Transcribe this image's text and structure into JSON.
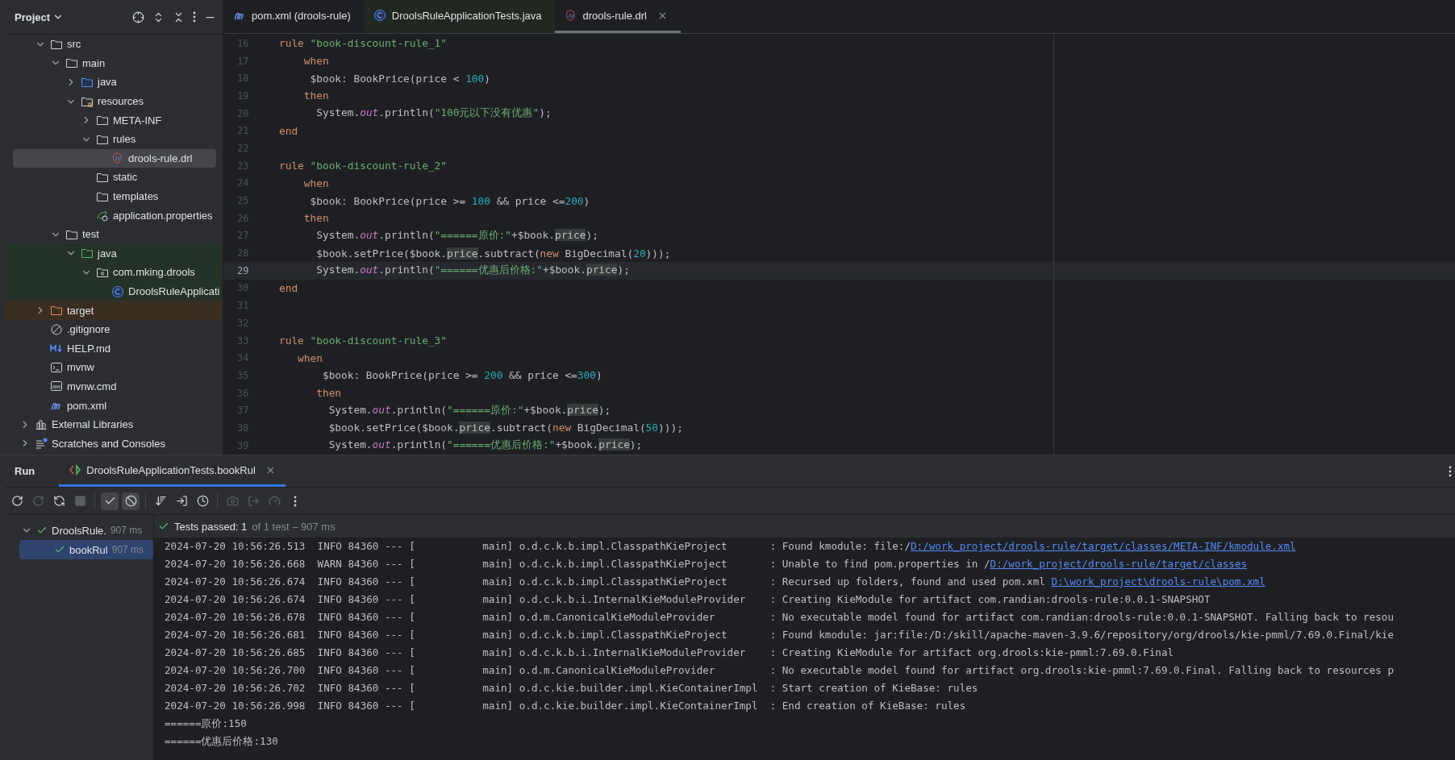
{
  "project_panel": {
    "title": "Project",
    "tree": {
      "nested_items": [
        {
          "label": "src",
          "kind": "folder",
          "expanded": true,
          "selected": false,
          "children": [
            {
              "label": "main",
              "kind": "folder",
              "expanded": true,
              "selected": false,
              "children": [
                {
                  "label": "java",
                  "kind": "source-folder",
                  "expanded": false,
                  "selected": false
                },
                {
                  "label": "resources",
                  "kind": "resource-folder",
                  "expanded": true,
                  "selected": false,
                  "children": [
                    {
                      "label": "META-INF",
                      "kind": "folder",
                      "expanded": false,
                      "selected": false
                    },
                    {
                      "label": "rules",
                      "kind": "folder",
                      "expanded": true,
                      "selected": false,
                      "children": [
                        {
                          "label": "drools-rule.drl",
                          "kind": "drl",
                          "selected": true
                        }
                      ]
                    },
                    {
                      "label": "static",
                      "kind": "folder",
                      "selected": false
                    },
                    {
                      "label": "templates",
                      "kind": "folder",
                      "selected": false
                    },
                    {
                      "label": "application.properties",
                      "kind": "properties",
                      "selected": false
                    }
                  ]
                }
              ]
            },
            {
              "label": "test",
              "kind": "folder",
              "expanded": true,
              "selected": false,
              "children": [
                {
                  "label": "java",
                  "kind": "test-folder",
                  "expanded": true,
                  "selected": false,
                  "test_source": true,
                  "children": [
                    {
                      "label": "com.mking.drools",
                      "kind": "package",
                      "expanded": true,
                      "selected": false,
                      "test_source": true,
                      "children": [
                        {
                          "label": "DroolsRuleApplicati",
                          "kind": "class",
                          "selected": false,
                          "test_source": true
                        }
                      ]
                    }
                  ]
                }
              ]
            }
          ]
        },
        {
          "label": "target",
          "kind": "excluded-folder",
          "expanded": false,
          "selected": false,
          "excluded": true
        },
        {
          "label": ".gitignore",
          "kind": "ignore",
          "selected": false
        },
        {
          "label": "HELP.md",
          "kind": "markdown",
          "selected": false
        },
        {
          "label": "mvnw",
          "kind": "shell",
          "selected": false
        },
        {
          "label": "mvnw.cmd",
          "kind": "cmd",
          "selected": false
        },
        {
          "label": "pom.xml",
          "kind": "maven",
          "selected": false
        }
      ],
      "top_items": [
        {
          "label": "External Libraries",
          "kind": "library",
          "expanded": false,
          "selected": false
        },
        {
          "label": "Scratches and Consoles",
          "kind": "scratches",
          "expanded": false,
          "selected": false
        }
      ]
    }
  },
  "editor": {
    "tabs": [
      {
        "label": "pom.xml (drools-rule)",
        "kind": "maven",
        "selected": false
      },
      {
        "label": "DroolsRuleApplicationTests.java",
        "kind": "class",
        "selected": false,
        "test_source": true
      },
      {
        "label": "drools-rule.drl",
        "kind": "drl",
        "selected": true
      }
    ],
    "lines": [
      {
        "number": "16",
        "current": false,
        "tokens": [
          {
            "kind": "keyword",
            "text": "rule "
          },
          {
            "kind": "string",
            "text": "\"book-discount-rule_1\""
          }
        ]
      },
      {
        "number": "17",
        "current": false,
        "tokens": [
          {
            "kind": "keyword",
            "text": "    when"
          }
        ]
      },
      {
        "number": "18",
        "current": false,
        "tokens": [
          {
            "kind": "plain",
            "text": "     $book: BookPrice(price < "
          },
          {
            "kind": "number",
            "text": "100"
          },
          {
            "kind": "plain",
            "text": ")"
          }
        ]
      },
      {
        "number": "19",
        "current": false,
        "tokens": [
          {
            "kind": "keyword",
            "text": "    then"
          }
        ]
      },
      {
        "number": "20",
        "current": false,
        "tokens": [
          {
            "kind": "plain",
            "text": "      System."
          },
          {
            "kind": "field",
            "text": "out"
          },
          {
            "kind": "plain",
            "text": ".println("
          },
          {
            "kind": "string",
            "text": "\"100元以下没有优惠\""
          },
          {
            "kind": "plain",
            "text": ");"
          }
        ]
      },
      {
        "number": "21",
        "current": false,
        "tokens": [
          {
            "kind": "keyword",
            "text": "end"
          }
        ]
      },
      {
        "number": "22",
        "current": false
      },
      {
        "number": "23",
        "current": false,
        "tokens": [
          {
            "kind": "keyword",
            "text": "rule "
          },
          {
            "kind": "string",
            "text": "\"book-discount-rule_2\""
          }
        ]
      },
      {
        "number": "24",
        "current": false,
        "tokens": [
          {
            "kind": "keyword",
            "text": "    when"
          }
        ]
      },
      {
        "number": "25",
        "current": false,
        "tokens": [
          {
            "kind": "plain",
            "text": "     $book: BookPrice(price >= "
          },
          {
            "kind": "number",
            "text": "100"
          },
          {
            "kind": "plain",
            "text": " && price <="
          },
          {
            "kind": "number",
            "text": "200"
          },
          {
            "kind": "plain",
            "text": ")"
          }
        ]
      },
      {
        "number": "26",
        "current": false,
        "tokens": [
          {
            "kind": "keyword",
            "text": "    then"
          }
        ]
      },
      {
        "number": "27",
        "current": false,
        "tokens": [
          {
            "kind": "plain",
            "text": "      System."
          },
          {
            "kind": "field",
            "text": "out"
          },
          {
            "kind": "plain",
            "text": ".println("
          },
          {
            "kind": "string",
            "text": "\"======原价:\""
          },
          {
            "kind": "plain",
            "text": "+$book."
          },
          {
            "kind": "ref",
            "text": "price"
          },
          {
            "kind": "plain",
            "text": ");"
          }
        ]
      },
      {
        "number": "28",
        "current": false,
        "tokens": [
          {
            "kind": "plain",
            "text": "      $book.setPrice($book."
          },
          {
            "kind": "ref",
            "text": "price"
          },
          {
            "kind": "plain",
            "text": ".subtract("
          },
          {
            "kind": "keyword",
            "text": "new"
          },
          {
            "kind": "plain",
            "text": " BigDecimal("
          },
          {
            "kind": "number",
            "text": "20"
          },
          {
            "kind": "plain",
            "text": ")));"
          }
        ]
      },
      {
        "number": "29",
        "current": true,
        "tokens": [
          {
            "kind": "plain",
            "text": "      System."
          },
          {
            "kind": "field",
            "text": "out"
          },
          {
            "kind": "plain",
            "text": ".println("
          },
          {
            "kind": "string",
            "text": "\"======优惠后价格:\""
          },
          {
            "kind": "plain",
            "text": "+$book."
          },
          {
            "kind": "ref",
            "text": "price"
          },
          {
            "kind": "plain",
            "text": ");"
          }
        ]
      },
      {
        "number": "30",
        "current": false,
        "tokens": [
          {
            "kind": "keyword",
            "text": "end"
          }
        ]
      },
      {
        "number": "31",
        "current": false
      },
      {
        "number": "32",
        "current": false
      },
      {
        "number": "33",
        "current": false,
        "tokens": [
          {
            "kind": "keyword",
            "text": "rule "
          },
          {
            "kind": "string",
            "text": "\"book-discount-rule_3\""
          }
        ]
      },
      {
        "number": "34",
        "current": false,
        "tokens": [
          {
            "kind": "keyword",
            "text": "   when"
          }
        ]
      },
      {
        "number": "35",
        "current": false,
        "tokens": [
          {
            "kind": "plain",
            "text": "       $book: BookPrice(price >= "
          },
          {
            "kind": "number",
            "text": "200"
          },
          {
            "kind": "plain",
            "text": " && price <="
          },
          {
            "kind": "number",
            "text": "300"
          },
          {
            "kind": "plain",
            "text": ")"
          }
        ]
      },
      {
        "number": "36",
        "current": false,
        "tokens": [
          {
            "kind": "keyword",
            "text": "      then"
          }
        ]
      },
      {
        "number": "37",
        "current": false,
        "tokens": [
          {
            "kind": "plain",
            "text": "        System."
          },
          {
            "kind": "field",
            "text": "out"
          },
          {
            "kind": "plain",
            "text": ".println("
          },
          {
            "kind": "string",
            "text": "\"======原价:\""
          },
          {
            "kind": "plain",
            "text": "+$book."
          },
          {
            "kind": "ref",
            "text": "price"
          },
          {
            "kind": "plain",
            "text": ");"
          }
        ]
      },
      {
        "number": "38",
        "current": false,
        "tokens": [
          {
            "kind": "plain",
            "text": "        $book.setPrice($book."
          },
          {
            "kind": "ref",
            "text": "price"
          },
          {
            "kind": "plain",
            "text": ".subtract("
          },
          {
            "kind": "keyword",
            "text": "new"
          },
          {
            "kind": "plain",
            "text": " BigDecimal("
          },
          {
            "kind": "number",
            "text": "50"
          },
          {
            "kind": "plain",
            "text": ")));"
          }
        ]
      },
      {
        "number": "39",
        "current": false,
        "tokens": [
          {
            "kind": "plain",
            "text": "        System."
          },
          {
            "kind": "field",
            "text": "out"
          },
          {
            "kind": "plain",
            "text": ".println("
          },
          {
            "kind": "string",
            "text": "\"======优惠后价格:\""
          },
          {
            "kind": "plain",
            "text": "+$book."
          },
          {
            "kind": "ref",
            "text": "price"
          },
          {
            "kind": "plain",
            "text": ");"
          }
        ]
      }
    ]
  },
  "run_panel": {
    "title": "Run",
    "tabs": [
      {
        "label": "DroolsRuleApplicationTests.bookRul",
        "selected": true
      }
    ],
    "toolbar": [
      {
        "kind": "rerun",
        "disabled": false,
        "on": false
      },
      {
        "kind": "rerun-failed",
        "disabled": true,
        "on": false
      },
      {
        "kind": "auto-rerun",
        "disabled": false,
        "on": false
      },
      {
        "kind": "stop",
        "disabled": true,
        "on": false
      },
      {
        "kind": "show-passed",
        "disabled": false,
        "on": true
      },
      {
        "kind": "show-ignored",
        "disabled": false,
        "on": true
      },
      {
        "kind": "sort",
        "disabled": false,
        "on": false
      },
      {
        "kind": "import",
        "disabled": false,
        "on": false
      },
      {
        "kind": "history",
        "disabled": false,
        "on": false
      },
      {
        "kind": "screenshot",
        "disabled": true,
        "on": false
      },
      {
        "kind": "export",
        "disabled": true,
        "on": false
      },
      {
        "kind": "coverage",
        "disabled": true,
        "on": false
      },
      {
        "kind": "more",
        "disabled": false,
        "on": false
      }
    ],
    "test_tree": [
      {
        "label": "DroolsRule.",
        "duration": "907 ms",
        "expanded": true,
        "selected": false,
        "children": [
          {
            "label": "bookRul",
            "duration": "907 ms",
            "selected": true
          }
        ]
      }
    ],
    "status": {
      "summary": "Tests passed: 1",
      "detail": "of 1 test – 907 ms"
    },
    "console": [
      {
        "text": "2024-07-20 10:56:26.513  INFO 84360 --- [           main] o.d.c.k.b.impl.ClasspathKieProject       : Found kmodule: file:/",
        "link": "D:/work_project/drools-rule/target/classes/META-INF/kmodule.xml"
      },
      {
        "text": "2024-07-20 10:56:26.668  WARN 84360 --- [           main] o.d.c.k.b.impl.ClasspathKieProject       : Unable to find pom.properties in /",
        "link": "D:/work_project/drools-rule/target/classes"
      },
      {
        "text": "2024-07-20 10:56:26.674  INFO 84360 --- [           main] o.d.c.k.b.impl.ClasspathKieProject       : Recursed up folders, found and used pom.xml ",
        "link": "D:\\work_project\\drools-rule\\pom.xml"
      },
      {
        "text": "2024-07-20 10:56:26.674  INFO 84360 --- [           main] o.d.c.k.b.i.InternalKieModuleProvider    : Creating KieModule for artifact com.randian:drools-rule:0.0.1-SNAPSHOT"
      },
      {
        "text": "2024-07-20 10:56:26.678  INFO 84360 --- [           main] o.d.m.CanonicalKieModuleProvider         : No executable model found for artifact com.randian:drools-rule:0.0.1-SNAPSHOT. Falling back to resou"
      },
      {
        "text": "2024-07-20 10:56:26.681  INFO 84360 --- [           main] o.d.c.k.b.impl.ClasspathKieProject       : Found kmodule: jar:file:/D:/skill/apache-maven-3.9.6/repository/org/drools/kie-pmml/7.69.0.Final/kie"
      },
      {
        "text": "2024-07-20 10:56:26.685  INFO 84360 --- [           main] o.d.c.k.b.i.InternalKieModuleProvider    : Creating KieModule for artifact org.drools:kie-pmml:7.69.0.Final"
      },
      {
        "text": "2024-07-20 10:56:26.700  INFO 84360 --- [           main] o.d.m.CanonicalKieModuleProvider         : No executable model found for artifact org.drools:kie-pmml:7.69.0.Final. Falling back to resources p"
      },
      {
        "text": "2024-07-20 10:56:26.702  INFO 84360 --- [           main] o.d.c.kie.builder.impl.KieContainerImpl  : Start creation of KieBase: rules"
      },
      {
        "text": "2024-07-20 10:56:26.998  INFO 84360 --- [           main] o.d.c.kie.builder.impl.KieContainerImpl  : End creation of KieBase: rules"
      },
      {
        "text": "======原价:150"
      },
      {
        "text": "======优惠后价格:130"
      }
    ]
  }
}
